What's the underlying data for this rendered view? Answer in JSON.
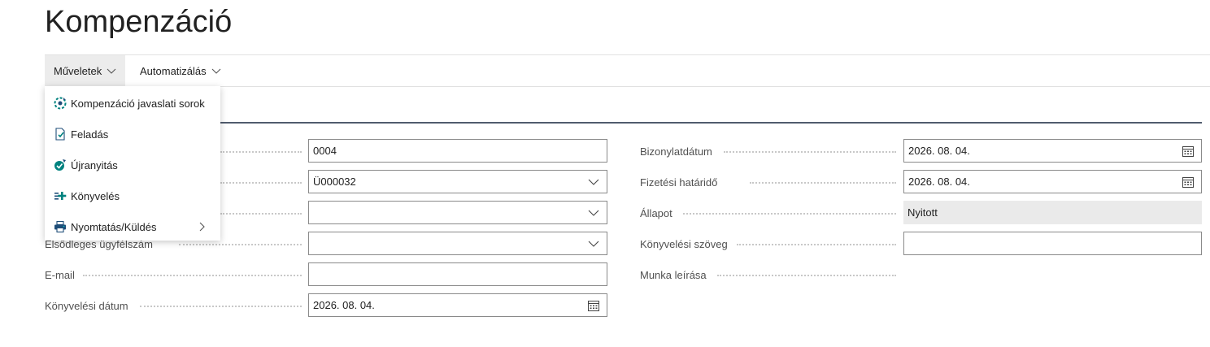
{
  "page": {
    "title": "Kompenzáció"
  },
  "action_bar": {
    "items": [
      {
        "label": "Műveletek"
      },
      {
        "label": "Automatizálás"
      }
    ]
  },
  "menu": {
    "items": [
      {
        "label": "Kompenzáció javaslati sorok",
        "icon": "suggest-lines-icon"
      },
      {
        "label": "Feladás",
        "icon": "release-document-icon"
      },
      {
        "label": "Újranyitás",
        "icon": "reopen-icon"
      },
      {
        "label": "Könyvelés",
        "icon": "post-icon"
      },
      {
        "label": "Nyomtatás/Küldés",
        "icon": "printer-icon"
      }
    ]
  },
  "form": {
    "left": {
      "no": {
        "value": "0004"
      },
      "customer": {
        "value": "Ü000032"
      },
      "primary_customer": {
        "label": "Elsődleges ügyfélszám",
        "value": ""
      },
      "email": {
        "label": "E-mail",
        "value": ""
      },
      "posting_date": {
        "label": "Könyvelési dátum",
        "value": "2026. 08. 04."
      }
    },
    "right": {
      "document_date": {
        "label": "Bizonylatdátum",
        "value": "2026. 08. 04."
      },
      "due_date": {
        "label": "Fizetési határidő",
        "value": "2026. 08. 04."
      },
      "status": {
        "label": "Állapot",
        "value": "Nyitott"
      },
      "posting_text": {
        "label": "Könyvelési szöveg",
        "value": ""
      },
      "job_description": {
        "label": "Munka leírása"
      }
    }
  },
  "colors": {
    "accent": "#00827f",
    "section_line": "#505c6d",
    "input_border": "#8a8a8a",
    "readonly_bg": "#eaeaea"
  }
}
